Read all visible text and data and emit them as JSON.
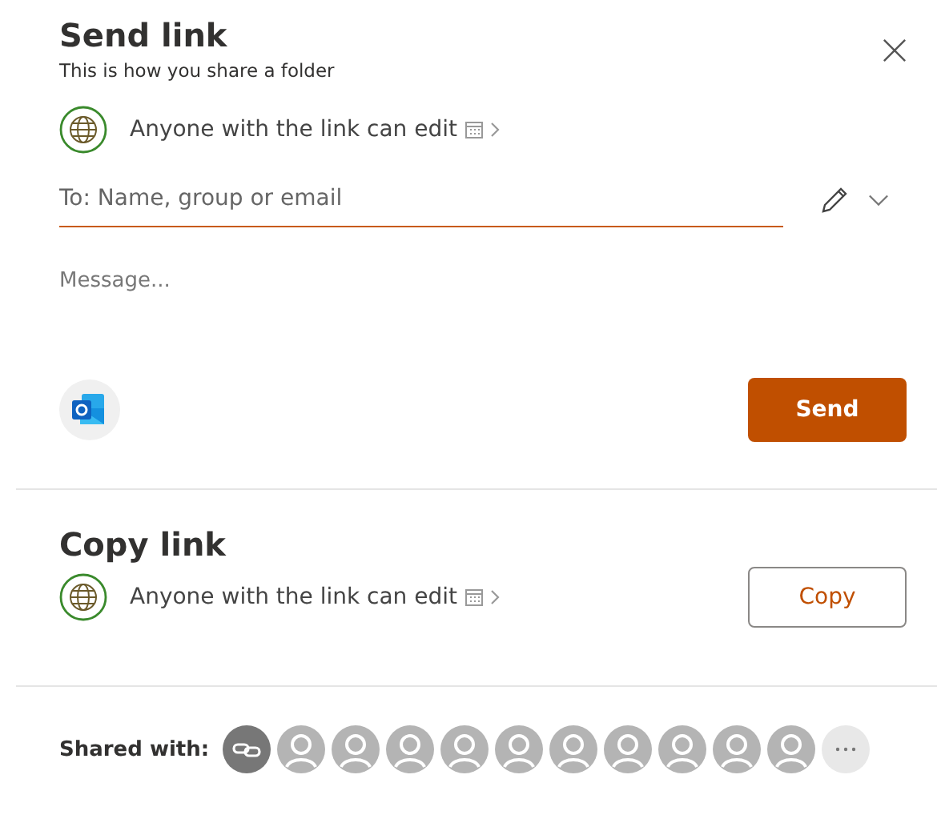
{
  "send_link": {
    "title": "Send link",
    "subtitle": "This is how you share a folder",
    "permission": "Anyone with the link can edit",
    "to_field": {
      "placeholder": "To: Name, group or email"
    },
    "message_field": {
      "placeholder": "Message..."
    },
    "send_button": "Send"
  },
  "copy_link": {
    "title": "Copy link",
    "permission": "Anyone with the link can edit",
    "copy_button": "Copy"
  },
  "shared_with": {
    "label": "Shared with:",
    "avatars": [
      {
        "kind": "link"
      },
      {
        "kind": "person"
      },
      {
        "kind": "person"
      },
      {
        "kind": "person"
      },
      {
        "kind": "person"
      },
      {
        "kind": "person"
      },
      {
        "kind": "person"
      },
      {
        "kind": "person"
      },
      {
        "kind": "person"
      },
      {
        "kind": "person"
      },
      {
        "kind": "person"
      },
      {
        "kind": "more"
      }
    ]
  }
}
